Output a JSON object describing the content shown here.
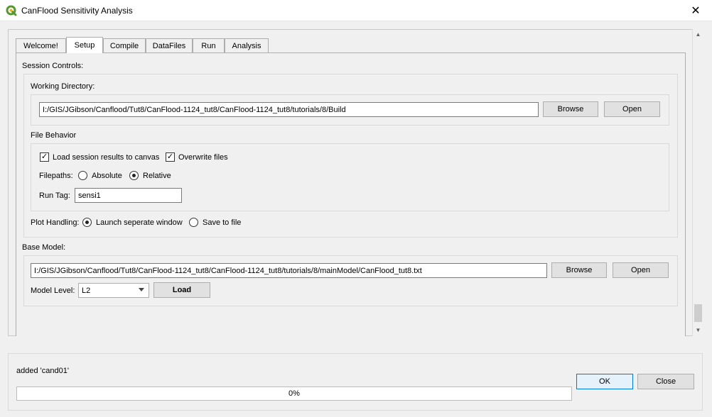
{
  "window": {
    "title": "CanFlood Sensitivity Analysis",
    "close_icon": "close-icon"
  },
  "tabs": [
    {
      "label": "Welcome!",
      "active": false
    },
    {
      "label": "Setup",
      "active": true
    },
    {
      "label": "Compile",
      "active": false
    },
    {
      "label": "DataFiles",
      "active": false
    },
    {
      "label": "Run",
      "active": false
    },
    {
      "label": "Analysis",
      "active": false
    }
  ],
  "session_controls": {
    "heading": "Session Controls:",
    "working_directory": {
      "label": "Working Directory:",
      "value": "I:/GIS/JGibson/Canflood/Tut8/CanFlood-1124_tut8/CanFlood-1124_tut8/tutorials/8/Build",
      "browse_label": "Browse",
      "open_label": "Open"
    },
    "file_behavior": {
      "label": "File Behavior",
      "load_results_label": "Load session results to canvas",
      "load_results_checked": true,
      "overwrite_label": "Overwrite files",
      "overwrite_checked": true,
      "filepaths_label": "Filepaths:",
      "absolute_label": "Absolute",
      "relative_label": "Relative",
      "filepaths_selected": "Relative",
      "run_tag_label": "Run Tag:",
      "run_tag_value": "sensi1"
    },
    "plot_handling": {
      "label": "Plot Handling:",
      "launch_label": "Launch seperate window",
      "save_label": "Save to file",
      "selected": "Launch seperate window"
    }
  },
  "base_model": {
    "heading": "Base Model:",
    "path": "I:/GIS/JGibson/Canflood/Tut8/CanFlood-1124_tut8/CanFlood-1124_tut8/tutorials/8/mainModel/CanFlood_tut8.txt",
    "browse_label": "Browse",
    "open_label": "Open",
    "model_level_label": "Model Level:",
    "model_level_value": "L2",
    "load_label": "Load"
  },
  "footer": {
    "status": "added 'cand01'",
    "progress_text": "0%",
    "progress_fraction": 0,
    "ok_label": "OK",
    "close_label": "Close"
  },
  "colors": {
    "accent": "#0078d7",
    "qgis_green": "#589632",
    "progress_fill": "#06b025"
  }
}
